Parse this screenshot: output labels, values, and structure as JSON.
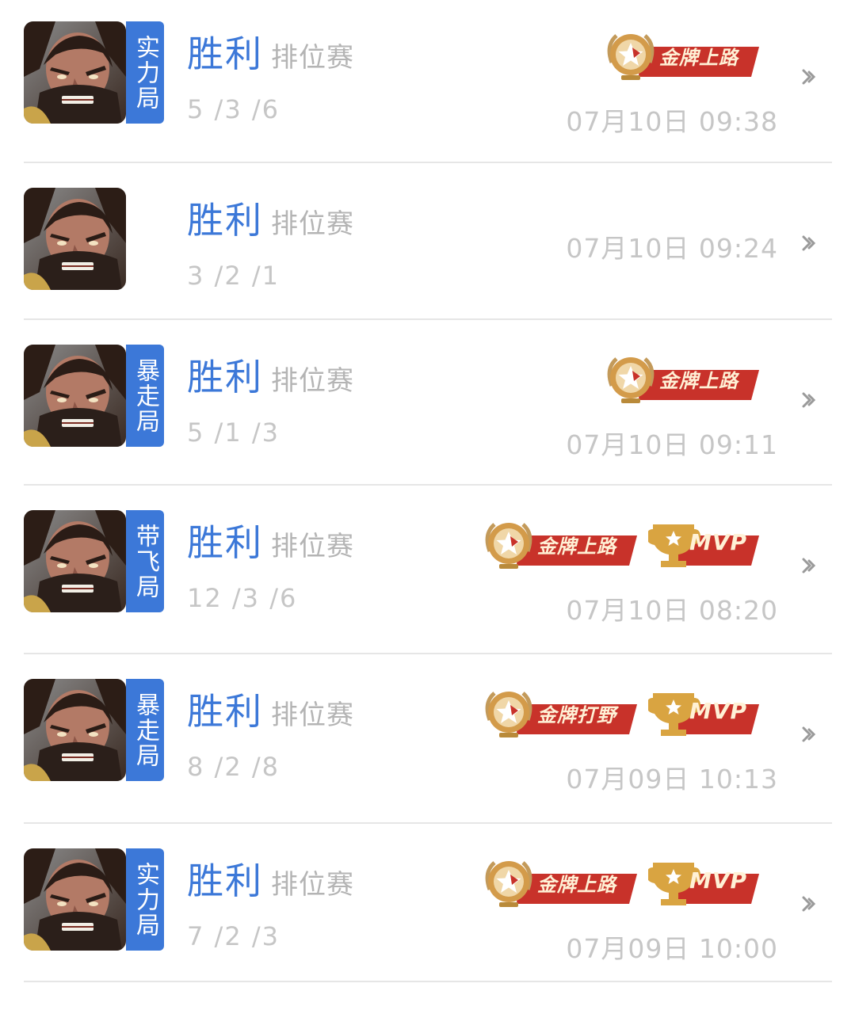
{
  "matches": [
    {
      "tag": "实力局",
      "result": "胜利",
      "mode": "排位赛",
      "kda": "5 /3 /6",
      "time": "07月10日 09:38",
      "badges": [
        {
          "type": "medal",
          "label": "金牌上路"
        }
      ]
    },
    {
      "tag": "",
      "result": "胜利",
      "mode": "排位赛",
      "kda": "3 /2 /1",
      "time": "07月10日 09:24",
      "badges": []
    },
    {
      "tag": "暴走局",
      "result": "胜利",
      "mode": "排位赛",
      "kda": "5 /1 /3",
      "time": "07月10日 09:11",
      "badges": [
        {
          "type": "medal",
          "label": "金牌上路"
        }
      ]
    },
    {
      "tag": "带飞局",
      "result": "胜利",
      "mode": "排位赛",
      "kda": "12 /3 /6",
      "time": "07月10日 08:20",
      "badges": [
        {
          "type": "medal",
          "label": "金牌上路"
        },
        {
          "type": "mvp",
          "label": "MVP"
        }
      ]
    },
    {
      "tag": "暴走局",
      "result": "胜利",
      "mode": "排位赛",
      "kda": "8 /2 /8",
      "time": "07月09日 10:13",
      "badges": [
        {
          "type": "medal",
          "label": "金牌打野"
        },
        {
          "type": "mvp",
          "label": "MVP"
        }
      ]
    },
    {
      "tag": "实力局",
      "result": "胜利",
      "mode": "排位赛",
      "kda": "7 /2 /3",
      "time": "07月09日 10:00",
      "badges": [
        {
          "type": "medal",
          "label": "金牌上路"
        },
        {
          "type": "mvp",
          "label": "MVP"
        }
      ]
    }
  ],
  "icons": {
    "avatar": "hero-portrait-icon",
    "medal": "gold-medal-icon",
    "mvp": "trophy-icon",
    "chevron": "chevron-right-icon"
  },
  "colors": {
    "accent": "#3c78d8",
    "badge_red": "#c8322a",
    "gold": "#d9a441",
    "muted": "#c6c6c6"
  }
}
